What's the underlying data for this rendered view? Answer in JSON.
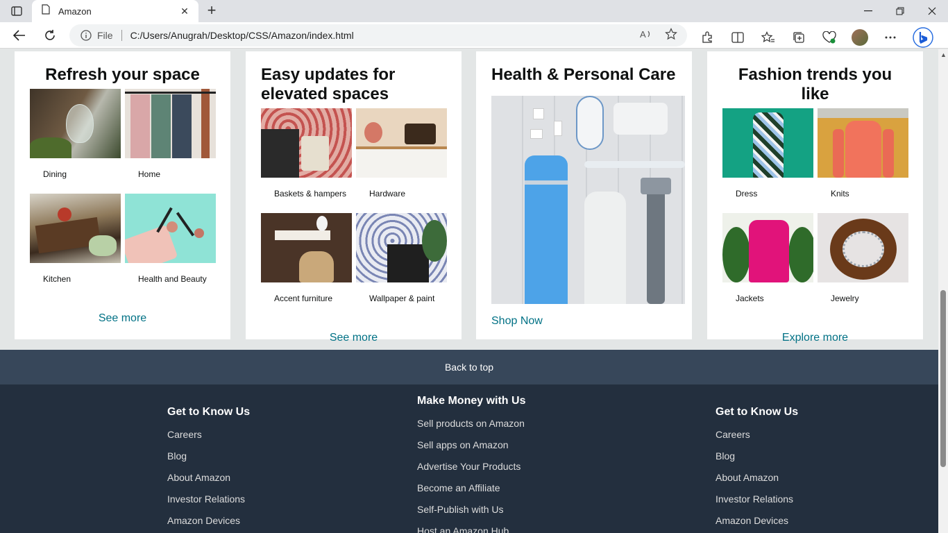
{
  "browser": {
    "tab_title": "Amazon",
    "address_prefix": "File",
    "url": "C:/Users/Anugrah/Desktop/CSS/Amazon/index.html"
  },
  "cards": [
    {
      "title": "Refresh your space",
      "items": [
        {
          "label": "Dining"
        },
        {
          "label": "Home"
        },
        {
          "label": "Kitchen"
        },
        {
          "label": "Health and Beauty"
        }
      ],
      "link": "See more"
    },
    {
      "title": "Easy updates for elevated spaces",
      "items": [
        {
          "label": "Baskets & hampers"
        },
        {
          "label": "Hardware"
        },
        {
          "label": "Accent furniture"
        },
        {
          "label": "Wallpaper & paint"
        }
      ],
      "link": "See more"
    },
    {
      "title": "Health & Personal Care",
      "link": "Shop Now"
    },
    {
      "title": "Fashion trends you like",
      "items": [
        {
          "label": "Dress"
        },
        {
          "label": "Knits"
        },
        {
          "label": "Jackets"
        },
        {
          "label": "Jewelry"
        }
      ],
      "link": "Explore more"
    }
  ],
  "back_to_top": "Back to top",
  "footer": {
    "columns": [
      {
        "heading": "Get to Know Us",
        "links": [
          "Careers",
          "Blog",
          "About Amazon",
          "Investor Relations",
          "Amazon Devices"
        ]
      },
      {
        "heading": "Make Money with Us",
        "links": [
          "Sell products on Amazon",
          "Sell apps on Amazon",
          "Advertise Your Products",
          "Become an Affiliate",
          "Self-Publish with Us",
          "Host an Amazon Hub"
        ]
      },
      {
        "heading": "Get to Know Us",
        "links": [
          "Careers",
          "Blog",
          "About Amazon",
          "Investor Relations",
          "Amazon Devices"
        ]
      }
    ]
  },
  "colors": {
    "link": "#007185",
    "back_to_top_bg": "#37475a",
    "footer_bg": "#232f3e",
    "page_bg": "#e3e6e6"
  }
}
